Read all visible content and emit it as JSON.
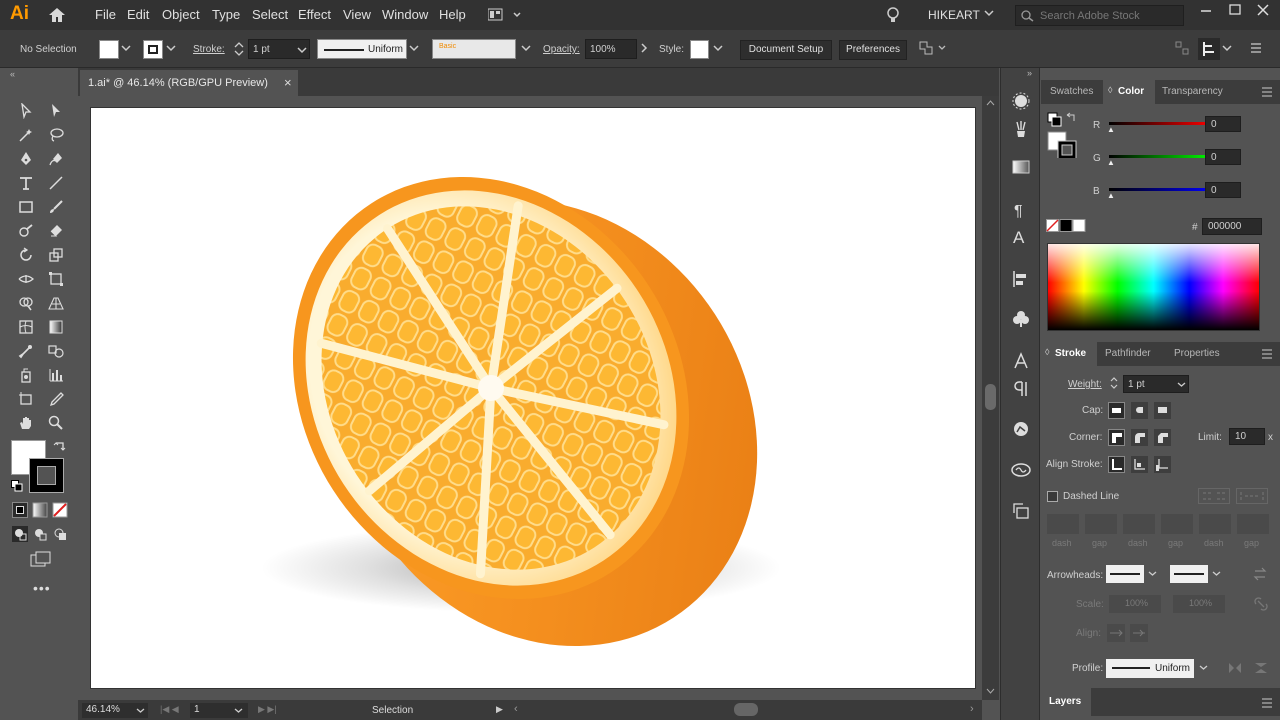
{
  "app": {
    "logo": "Ai",
    "user": "HIKEART"
  },
  "menu": [
    "File",
    "Edit",
    "Object",
    "Type",
    "Select",
    "Effect",
    "View",
    "Window",
    "Help"
  ],
  "search": {
    "placeholder": "Search Adobe Stock"
  },
  "control": {
    "selection": "No Selection",
    "stroke_label": "Stroke:",
    "stroke_weight": "1 pt",
    "stroke_profile": "Uniform",
    "brush": "Basic",
    "opacity_label": "Opacity:",
    "opacity_value": "100%",
    "style_label": "Style:",
    "doc_setup": "Document Setup",
    "preferences": "Preferences"
  },
  "document": {
    "tab_title": "1.ai* @ 46.14% (RGB/GPU Preview)"
  },
  "status": {
    "zoom": "46.14%",
    "artboard": "1",
    "tool": "Selection"
  },
  "colors": {
    "orange_rind": "#f5901f",
    "orange_flesh": "#fbb13a",
    "pith": "#fff6d8",
    "canvas": "#ffffff"
  },
  "color_panel": {
    "tabs": [
      "Swatches",
      "Color",
      "Transparency"
    ],
    "active_tab": "Color",
    "channels": [
      {
        "label": "R",
        "value": "0"
      },
      {
        "label": "G",
        "value": "0"
      },
      {
        "label": "B",
        "value": "0"
      }
    ],
    "hex_symbol": "#",
    "hex": "000000"
  },
  "stroke_panel": {
    "tabs": [
      "Stroke",
      "Pathfinder",
      "Properties"
    ],
    "active_tab": "Stroke",
    "weight_label": "Weight:",
    "weight": "1 pt",
    "cap_label": "Cap:",
    "corner_label": "Corner:",
    "limit_label": "Limit:",
    "limit": "10",
    "limit_unit": "x",
    "align_label": "Align Stroke:",
    "dashed_label": "Dashed Line",
    "dash_labels": [
      "dash",
      "gap",
      "dash",
      "gap",
      "dash",
      "gap"
    ],
    "arrowheads_label": "Arrowheads:",
    "scale_label": "Scale:",
    "scale1": "100%",
    "scale2": "100%",
    "align_arrow_label": "Align:",
    "profile_label": "Profile:",
    "profile": "Uniform"
  },
  "layers_panel": {
    "title": "Layers"
  }
}
